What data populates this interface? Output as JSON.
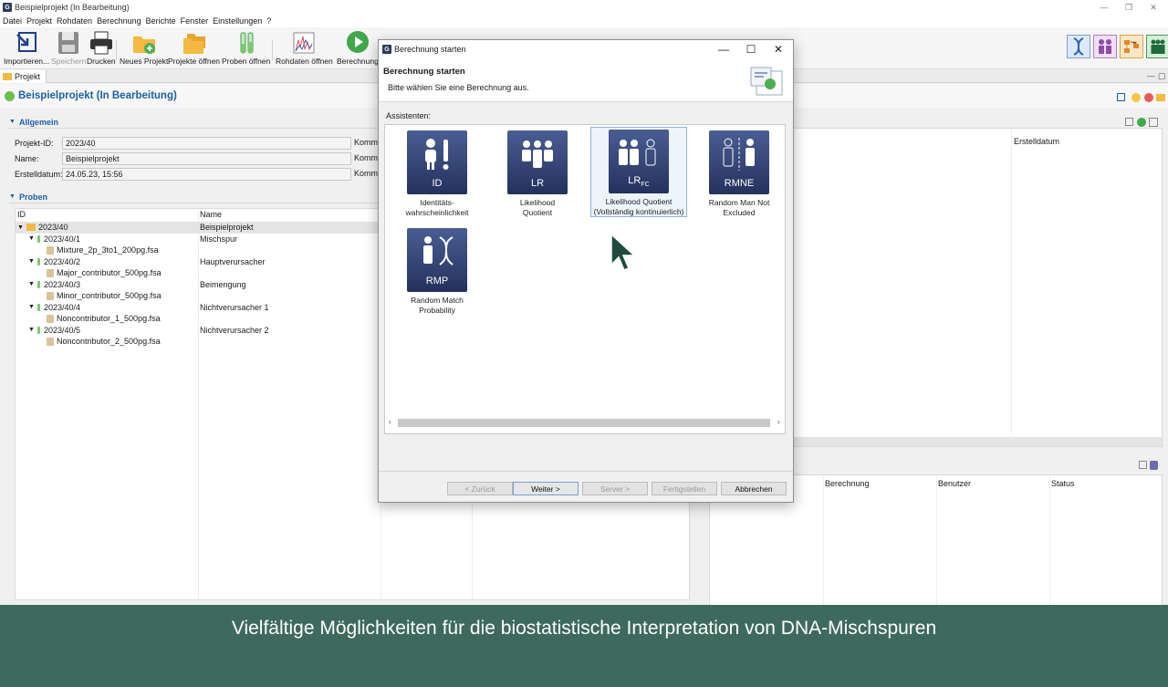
{
  "window": {
    "title": "Beispielprojekt (In Bearbeitung)",
    "app_letter": "G"
  },
  "menu": [
    "Datei",
    "Projekt",
    "Rohdaten",
    "Berechnung",
    "Berichte",
    "Fenster",
    "Einstellungen",
    "?"
  ],
  "toolbar": {
    "import": "Importieren...",
    "save": "Speichern",
    "print": "Drucken",
    "new_project": "Neues Projekt",
    "open_projects": "Projekte öffnen",
    "open_samples": "Proben öffnen",
    "open_rawdata": "Rohdaten öffnen",
    "calculation": "Berechnung"
  },
  "tab": {
    "label": "Projekt"
  },
  "project": {
    "title": "Beispielprojekt (In Bearbeitung)",
    "status_color": "#6cc04a"
  },
  "general": {
    "heading": "Allgemein",
    "fields": [
      {
        "label": "Projekt-ID:",
        "value": "2023/40",
        "side": "Komme"
      },
      {
        "label": "Name:",
        "value": "Beispielprojekt",
        "side": "Komme"
      },
      {
        "label": "Erstelldatum:",
        "value": "24.05.23, 15:56",
        "side": "Komme"
      }
    ]
  },
  "samples": {
    "heading": "Proben",
    "columns": [
      "ID",
      "Name"
    ],
    "rows": [
      {
        "id": "2023/40",
        "name": "Beispielprojekt"
      },
      {
        "id": "2023/40/1",
        "name": "Mischspur"
      },
      {
        "id": "Mixture_2p_3to1_200pg.fsa",
        "name": ""
      },
      {
        "id": "2023/40/2",
        "name": "Hauptverursacher"
      },
      {
        "id": "Major_contributor_500pg.fsa",
        "name": ""
      },
      {
        "id": "2023/40/3",
        "name": "Beimengung"
      },
      {
        "id": "Minor_contributor_500pg.fsa",
        "name": ""
      },
      {
        "id": "2023/40/4",
        "name": "Nichtverursacher 1"
      },
      {
        "id": "Noncontributor_1_500pg.fsa",
        "name": ""
      },
      {
        "id": "2023/40/5",
        "name": "Nichtverursacher 2"
      },
      {
        "id": "Noncontributor_2_500pg.fsa",
        "name": ""
      }
    ]
  },
  "right_panel": {
    "column": "Erstelldatum"
  },
  "calc_panel": {
    "columns": [
      "Berechnung",
      "Benutzer",
      "Status"
    ]
  },
  "dialog": {
    "window_title": "Berechnung starten",
    "heading": "Berechnung starten",
    "subtitle": "Bitte wählen Sie eine Berechnung aus.",
    "section": "Assistenten:",
    "cards": [
      {
        "abbr": "ID",
        "caption1": "Identitäts-",
        "caption2": "wahrscheinlichkeit"
      },
      {
        "abbr": "LR",
        "caption1": "Likelihood",
        "caption2": "Quotient"
      },
      {
        "abbr": "LR",
        "abbr_sub": "FC",
        "caption1": "Likelihood Quotient",
        "caption2": "(Vollständig kontinuierlich)"
      },
      {
        "abbr": "RMNE",
        "caption1": "Random Man Not",
        "caption2": "Excluded"
      },
      {
        "abbr": "RMP",
        "caption1": "Random Match",
        "caption2": "Probability"
      }
    ],
    "buttons": {
      "back": "< Zurück",
      "next": "Weiter >",
      "server": "Server >",
      "finish": "Fertigstellen",
      "cancel": "Abbrechen"
    }
  },
  "banner": {
    "text": "Vielfältige Möglichkeiten für die biostatistische Interpretation von DNA-Mischspuren",
    "color": "#3e6a5d"
  }
}
